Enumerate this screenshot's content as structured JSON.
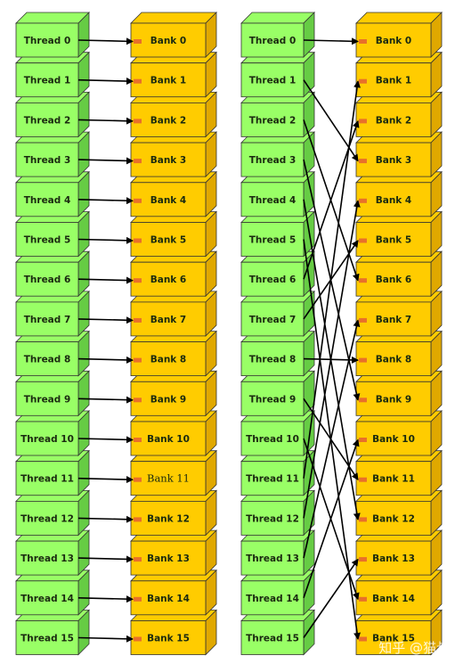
{
  "threads": [
    "Thread 0",
    "Thread 1",
    "Thread 2",
    "Thread 3",
    "Thread 4",
    "Thread 5",
    "Thread 6",
    "Thread 7",
    "Thread 8",
    "Thread 9",
    "Thread 10",
    "Thread 11",
    "Thread 12",
    "Thread 13",
    "Thread 14",
    "Thread 15"
  ],
  "banks": [
    "Bank 0",
    "Bank 1",
    "Bank 2",
    "Bank 3",
    "Bank 4",
    "Bank 5",
    "Bank 6",
    "Bank 7",
    "Bank 8",
    "Bank 9",
    "Bank 10",
    "Bank 11",
    "Bank 12",
    "Bank 13",
    "Bank 14",
    "Bank 15"
  ],
  "diagrams": [
    {
      "mapping": [
        0,
        1,
        2,
        3,
        4,
        5,
        6,
        7,
        8,
        9,
        10,
        11,
        12,
        13,
        14,
        15
      ]
    },
    {
      "mapping": [
        0,
        3,
        6,
        9,
        12,
        15,
        2,
        5,
        8,
        11,
        14,
        1,
        4,
        7,
        10,
        13
      ]
    }
  ],
  "colors": {
    "thread": "#99ff66",
    "thread_side": "#66cc44",
    "bank": "#ffcc00",
    "bank_side": "#e0a800",
    "port": "#e8702a"
  },
  "watermark": "知乎 @猫叔"
}
